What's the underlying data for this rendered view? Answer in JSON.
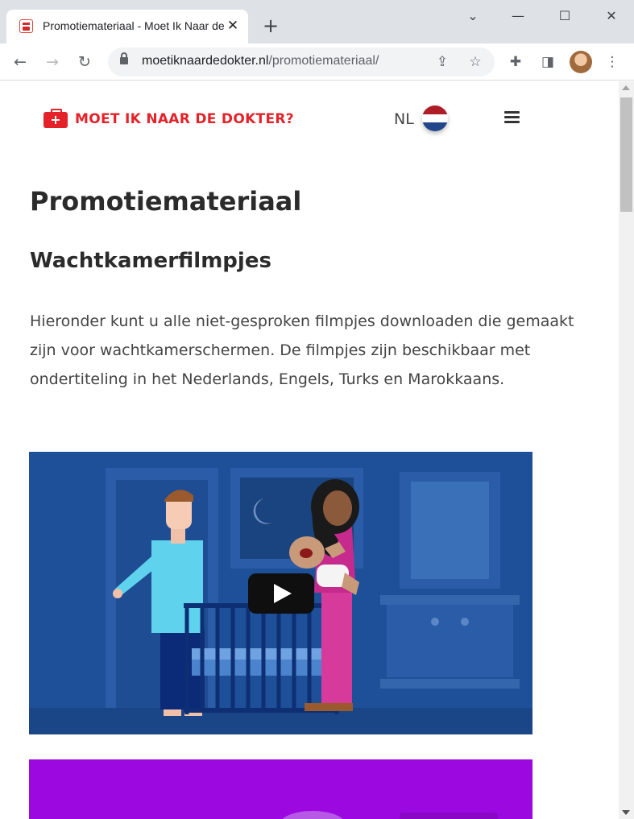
{
  "browser": {
    "tab_title": "Promotiemateriaal - Moet Ik Naar de Dokter?",
    "tab_close": "✕",
    "new_tab": "+",
    "url_domain": "moetiknaardedokter.nl",
    "url_path": "/promotiemateriaal/",
    "window_controls": {
      "dropdown": "⌄",
      "minimize": "—",
      "maximize": "☐",
      "close": "✕"
    },
    "nav": {
      "back": "←",
      "forward": "→",
      "reload": "↻"
    },
    "omnibox_icons": {
      "share": "⇪",
      "bookmark": "☆"
    },
    "toolbar_icons": {
      "extensions": "✚",
      "side_panel": "◨",
      "menu": "⋮"
    }
  },
  "site": {
    "logo_text": "MOET IK NAAR DE DOKTER?",
    "logo_cross": "+",
    "language": "NL",
    "flag_colors": [
      "#ae1c28",
      "#ffffff",
      "#21468b"
    ]
  },
  "content": {
    "title": "Promotiemateriaal",
    "subtitle": "Wachtkamerfilmpjes",
    "intro": "Hieronder kunt u alle niet-gesproken filmpjes downloaden die gemaakt zijn voor wachtkamerschermen. De filmpjes zijn beschikbaar met ondertiteling in het Nederlands, Engels, Turks en Marokkaans."
  },
  "colors": {
    "brand_red": "#e3222a",
    "video1_bg": "#1e4f99",
    "video2_bg": "#9c09e0"
  }
}
